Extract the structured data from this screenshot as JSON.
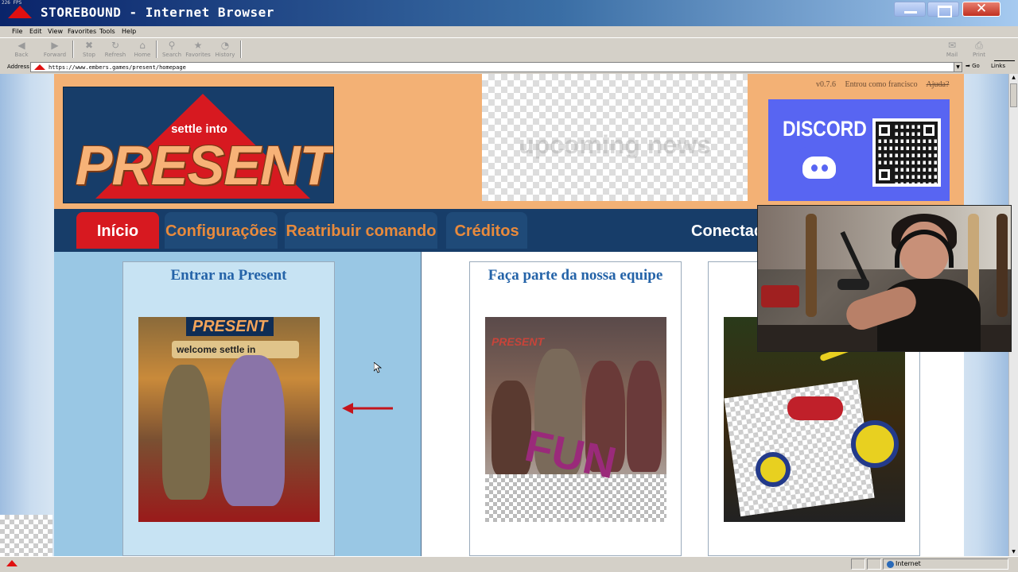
{
  "window": {
    "fps": "226 FPS",
    "title": "STOREBOUND - Internet Browser",
    "close_glyph": "✕"
  },
  "menu": [
    "File",
    "Edit",
    "View",
    "Favorites",
    "Tools",
    "Help"
  ],
  "toolbar": {
    "buttons": [
      {
        "label": "Back",
        "icon": "back-arrow-icon"
      },
      {
        "label": "Forward",
        "icon": "forward-arrow-icon"
      },
      {
        "label": "Stop",
        "icon": "stop-icon"
      },
      {
        "label": "Refresh",
        "icon": "refresh-icon"
      },
      {
        "label": "Home",
        "icon": "home-icon"
      },
      {
        "label": "Search",
        "icon": "search-icon"
      },
      {
        "label": "Favorites",
        "icon": "star-icon"
      },
      {
        "label": "History",
        "icon": "history-icon"
      },
      {
        "label": "Mail",
        "icon": "mail-icon"
      },
      {
        "label": "Print",
        "icon": "print-icon"
      }
    ]
  },
  "address": {
    "label": "Address",
    "url": "https://www.embers.games/present/homepage",
    "go": "Go",
    "links": "Links"
  },
  "header": {
    "logo_small": "settle into",
    "logo_big": "PRESENT",
    "news_text": "upcoming news",
    "version": "v0.7.6",
    "logged_in": "Entrou como francisco",
    "help": "Ajuda?",
    "discord_label": "DISCORD"
  },
  "nav": {
    "tabs": [
      "Início",
      "Configurações",
      "Reatribuir comando",
      "Créditos"
    ],
    "connect": "Conectado"
  },
  "cards": [
    {
      "title": "Entrar na Present",
      "banner": "PRESENT",
      "sign": "welcome   settle in"
    },
    {
      "title": "Faça parte da nossa equipe",
      "banner": "PRESENT",
      "overlay": "FUN"
    },
    {
      "title": ""
    }
  ],
  "status": {
    "zone": "Internet"
  },
  "colors": {
    "accent_red": "#d71920",
    "nav_blue": "#173d69",
    "header_orange": "#f3b175",
    "tab_text": "#e88a3c",
    "card_title": "#2463a8",
    "discord": "#5865f2"
  }
}
